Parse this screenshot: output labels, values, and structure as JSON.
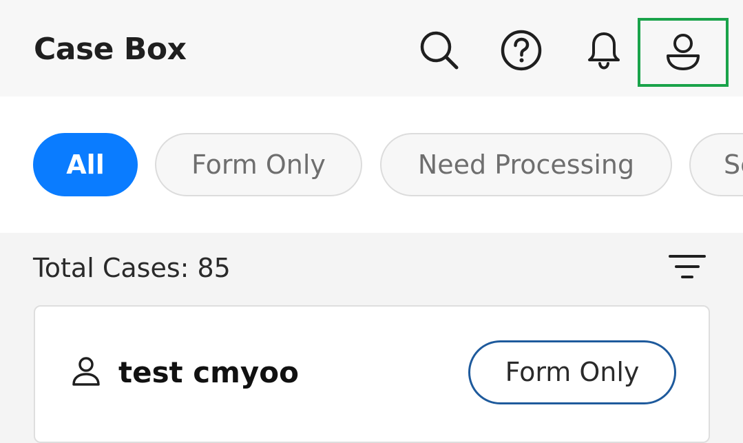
{
  "header": {
    "title": "Case Box",
    "icons": [
      "search-icon",
      "help-icon",
      "bell-icon",
      "profile-icon"
    ],
    "highlight_color": "#1aa34a"
  },
  "filters": {
    "chips": [
      {
        "label": "All",
        "active": true
      },
      {
        "label": "Form Only",
        "active": false
      },
      {
        "label": "Need Processing",
        "active": false
      },
      {
        "label": "Se",
        "active": false
      }
    ],
    "active_color": "#0a7cff"
  },
  "summary": {
    "total_label": "Total Cases: 85",
    "sort_icon": "sort-icon"
  },
  "cases": [
    {
      "name": "test cmyoo",
      "status": "Form Only",
      "icon": "person-icon"
    }
  ]
}
